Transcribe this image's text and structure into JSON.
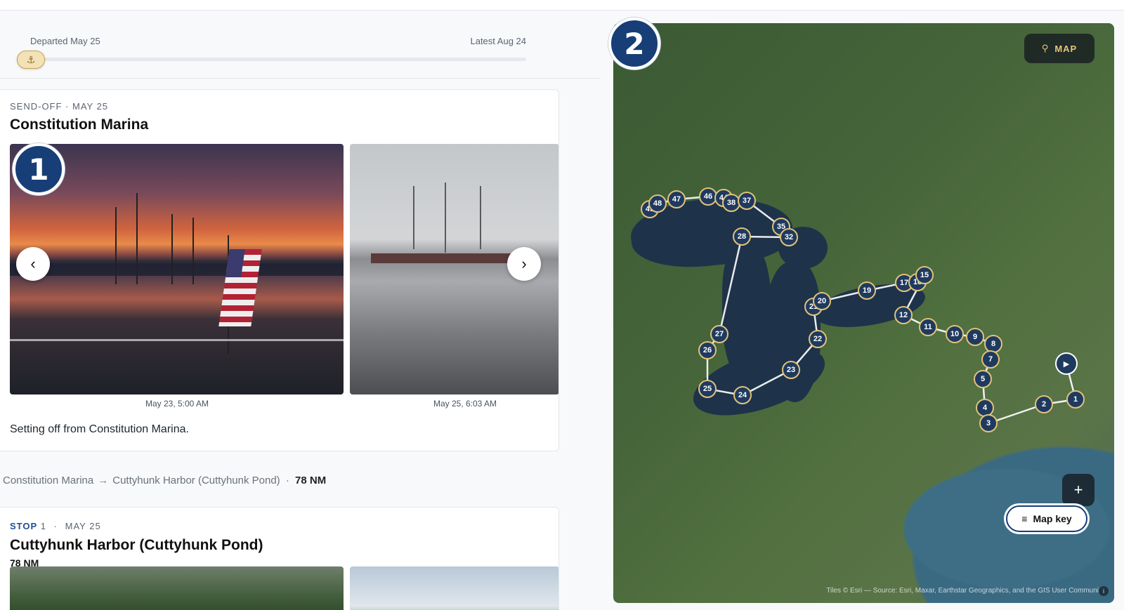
{
  "timeline": {
    "start_label": "Departed May 25",
    "end_label": "Latest Aug 24",
    "progress": 0,
    "handle_icon": "anchor-icon"
  },
  "cards": [
    {
      "eyebrow": "SEND-OFF · MAY 25",
      "title": "Constitution Marina",
      "badge": "1",
      "photos": [
        {
          "caption": "May 23, 5:00 AM"
        },
        {
          "caption": "May 25, 6:03 AM"
        }
      ],
      "description": "Setting off from Constitution Marina."
    },
    {
      "stop_label": "STOP",
      "stop_number": "1",
      "date": "MAY 25",
      "title": "Cuttyhunk Harbor (Cuttyhunk Pond)",
      "distance": "78 NM"
    }
  ],
  "leg": {
    "from": "Constitution Marina",
    "to": "Cuttyhunk Harbor (Cuttyhunk Pond)",
    "distance": "78 NM",
    "separator": "·",
    "arrow": "→"
  },
  "map": {
    "badge": "2",
    "map_button_label": "MAP",
    "zoom_in_label": "+",
    "map_key_label": "Map key",
    "attribution": "Tiles © Esri — Source: Esri, Maxar, Earthstar Geographics, and the GIS User Communi",
    "info_label": "i",
    "markers": [
      {
        "label": "49"
      },
      {
        "label": "48"
      },
      {
        "label": "47"
      },
      {
        "label": "46"
      },
      {
        "label": "44"
      },
      {
        "label": "38"
      },
      {
        "label": "37"
      },
      {
        "label": "35"
      },
      {
        "label": "32"
      },
      {
        "label": "28"
      },
      {
        "label": "27"
      },
      {
        "label": "26"
      },
      {
        "label": "25"
      },
      {
        "label": "24"
      },
      {
        "label": "23"
      },
      {
        "label": "22"
      },
      {
        "label": "21"
      },
      {
        "label": "20"
      },
      {
        "label": "19"
      },
      {
        "label": "17"
      },
      {
        "label": "16"
      },
      {
        "label": "15"
      },
      {
        "label": "12"
      },
      {
        "label": "11"
      },
      {
        "label": "10"
      },
      {
        "label": "9"
      },
      {
        "label": "8"
      },
      {
        "label": "7"
      },
      {
        "label": "5"
      },
      {
        "label": "4"
      },
      {
        "label": "3"
      },
      {
        "label": "2"
      },
      {
        "label": "1"
      }
    ]
  }
}
